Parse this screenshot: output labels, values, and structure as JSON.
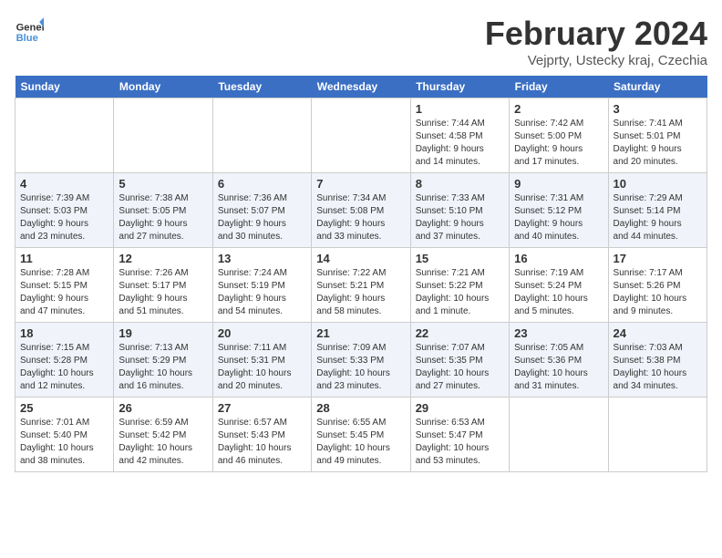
{
  "logo": {
    "line1": "General",
    "line2": "Blue"
  },
  "title": "February 2024",
  "location": "Vejprty, Ustecky kraj, Czechia",
  "weekdays": [
    "Sunday",
    "Monday",
    "Tuesday",
    "Wednesday",
    "Thursday",
    "Friday",
    "Saturday"
  ],
  "weeks": [
    [
      {
        "day": "",
        "info": ""
      },
      {
        "day": "",
        "info": ""
      },
      {
        "day": "",
        "info": ""
      },
      {
        "day": "",
        "info": ""
      },
      {
        "day": "1",
        "info": "Sunrise: 7:44 AM\nSunset: 4:58 PM\nDaylight: 9 hours\nand 14 minutes."
      },
      {
        "day": "2",
        "info": "Sunrise: 7:42 AM\nSunset: 5:00 PM\nDaylight: 9 hours\nand 17 minutes."
      },
      {
        "day": "3",
        "info": "Sunrise: 7:41 AM\nSunset: 5:01 PM\nDaylight: 9 hours\nand 20 minutes."
      }
    ],
    [
      {
        "day": "4",
        "info": "Sunrise: 7:39 AM\nSunset: 5:03 PM\nDaylight: 9 hours\nand 23 minutes."
      },
      {
        "day": "5",
        "info": "Sunrise: 7:38 AM\nSunset: 5:05 PM\nDaylight: 9 hours\nand 27 minutes."
      },
      {
        "day": "6",
        "info": "Sunrise: 7:36 AM\nSunset: 5:07 PM\nDaylight: 9 hours\nand 30 minutes."
      },
      {
        "day": "7",
        "info": "Sunrise: 7:34 AM\nSunset: 5:08 PM\nDaylight: 9 hours\nand 33 minutes."
      },
      {
        "day": "8",
        "info": "Sunrise: 7:33 AM\nSunset: 5:10 PM\nDaylight: 9 hours\nand 37 minutes."
      },
      {
        "day": "9",
        "info": "Sunrise: 7:31 AM\nSunset: 5:12 PM\nDaylight: 9 hours\nand 40 minutes."
      },
      {
        "day": "10",
        "info": "Sunrise: 7:29 AM\nSunset: 5:14 PM\nDaylight: 9 hours\nand 44 minutes."
      }
    ],
    [
      {
        "day": "11",
        "info": "Sunrise: 7:28 AM\nSunset: 5:15 PM\nDaylight: 9 hours\nand 47 minutes."
      },
      {
        "day": "12",
        "info": "Sunrise: 7:26 AM\nSunset: 5:17 PM\nDaylight: 9 hours\nand 51 minutes."
      },
      {
        "day": "13",
        "info": "Sunrise: 7:24 AM\nSunset: 5:19 PM\nDaylight: 9 hours\nand 54 minutes."
      },
      {
        "day": "14",
        "info": "Sunrise: 7:22 AM\nSunset: 5:21 PM\nDaylight: 9 hours\nand 58 minutes."
      },
      {
        "day": "15",
        "info": "Sunrise: 7:21 AM\nSunset: 5:22 PM\nDaylight: 10 hours\nand 1 minute."
      },
      {
        "day": "16",
        "info": "Sunrise: 7:19 AM\nSunset: 5:24 PM\nDaylight: 10 hours\nand 5 minutes."
      },
      {
        "day": "17",
        "info": "Sunrise: 7:17 AM\nSunset: 5:26 PM\nDaylight: 10 hours\nand 9 minutes."
      }
    ],
    [
      {
        "day": "18",
        "info": "Sunrise: 7:15 AM\nSunset: 5:28 PM\nDaylight: 10 hours\nand 12 minutes."
      },
      {
        "day": "19",
        "info": "Sunrise: 7:13 AM\nSunset: 5:29 PM\nDaylight: 10 hours\nand 16 minutes."
      },
      {
        "day": "20",
        "info": "Sunrise: 7:11 AM\nSunset: 5:31 PM\nDaylight: 10 hours\nand 20 minutes."
      },
      {
        "day": "21",
        "info": "Sunrise: 7:09 AM\nSunset: 5:33 PM\nDaylight: 10 hours\nand 23 minutes."
      },
      {
        "day": "22",
        "info": "Sunrise: 7:07 AM\nSunset: 5:35 PM\nDaylight: 10 hours\nand 27 minutes."
      },
      {
        "day": "23",
        "info": "Sunrise: 7:05 AM\nSunset: 5:36 PM\nDaylight: 10 hours\nand 31 minutes."
      },
      {
        "day": "24",
        "info": "Sunrise: 7:03 AM\nSunset: 5:38 PM\nDaylight: 10 hours\nand 34 minutes."
      }
    ],
    [
      {
        "day": "25",
        "info": "Sunrise: 7:01 AM\nSunset: 5:40 PM\nDaylight: 10 hours\nand 38 minutes."
      },
      {
        "day": "26",
        "info": "Sunrise: 6:59 AM\nSunset: 5:42 PM\nDaylight: 10 hours\nand 42 minutes."
      },
      {
        "day": "27",
        "info": "Sunrise: 6:57 AM\nSunset: 5:43 PM\nDaylight: 10 hours\nand 46 minutes."
      },
      {
        "day": "28",
        "info": "Sunrise: 6:55 AM\nSunset: 5:45 PM\nDaylight: 10 hours\nand 49 minutes."
      },
      {
        "day": "29",
        "info": "Sunrise: 6:53 AM\nSunset: 5:47 PM\nDaylight: 10 hours\nand 53 minutes."
      },
      {
        "day": "",
        "info": ""
      },
      {
        "day": "",
        "info": ""
      }
    ]
  ]
}
